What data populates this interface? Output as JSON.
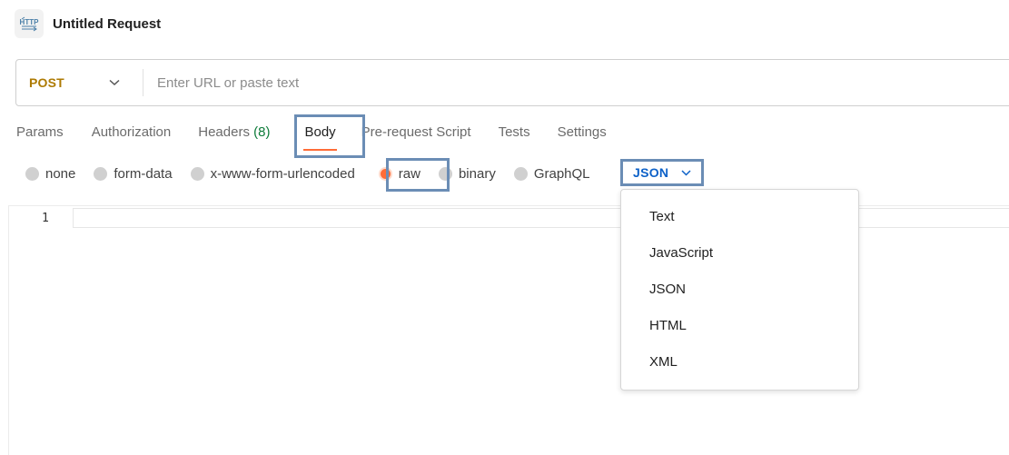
{
  "request": {
    "title": "Untitled Request",
    "icon": "http-icon"
  },
  "url_bar": {
    "method": "POST",
    "url_placeholder": "Enter URL or paste text",
    "url_value": ""
  },
  "tabs": {
    "params": "Params",
    "authorization": "Authorization",
    "headers": "Headers",
    "headers_count": "(8)",
    "body": "Body",
    "pre_request_script": "Pre-request Script",
    "tests": "Tests",
    "settings": "Settings",
    "active": "Body"
  },
  "body_types": {
    "none": "none",
    "form_data": "form-data",
    "urlencoded": "x-www-form-urlencoded",
    "raw": "raw",
    "binary": "binary",
    "graphql": "GraphQL",
    "selected": "raw"
  },
  "language": {
    "selected": "JSON",
    "options": [
      "Text",
      "JavaScript",
      "JSON",
      "HTML",
      "XML"
    ]
  },
  "editor": {
    "line_number": "1"
  },
  "colors": {
    "method": "#ad7a03",
    "accent": "#ff6c37",
    "language": "#0c61c8",
    "headers_count": "#0e7c3a",
    "highlight_box": "#6b8db5"
  }
}
